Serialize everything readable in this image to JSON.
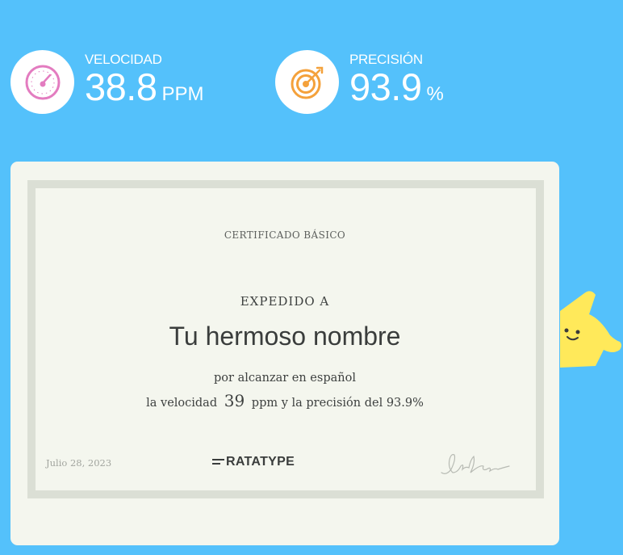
{
  "stats": {
    "speed": {
      "label": "VELOCIDAD",
      "value": "38.8",
      "unit": "PPM",
      "icon": "speedometer-icon"
    },
    "accuracy": {
      "label": "PRECISIÓN",
      "value": "93.9",
      "unit": "%",
      "icon": "target-icon"
    }
  },
  "certificate": {
    "title": "CERTIFICADO BÁSICO",
    "issued_to": "EXPEDIDO A",
    "name": "Tu hermoso nombre",
    "line1": "por alcanzar en español",
    "line2_prefix": "la velocidad",
    "line2_speed": "39",
    "line2_suffix": "ppm y la precisión del 93.9%",
    "date": "Julio 28, 2023",
    "logo": "RATATYPE"
  },
  "colors": {
    "background": "#54c1fb",
    "speed_icon": "#e37cc0",
    "target_icon": "#f4a13b",
    "card": "#f4f6ee",
    "frame": "#dbdfd5",
    "mascot": "#ffe95a"
  }
}
